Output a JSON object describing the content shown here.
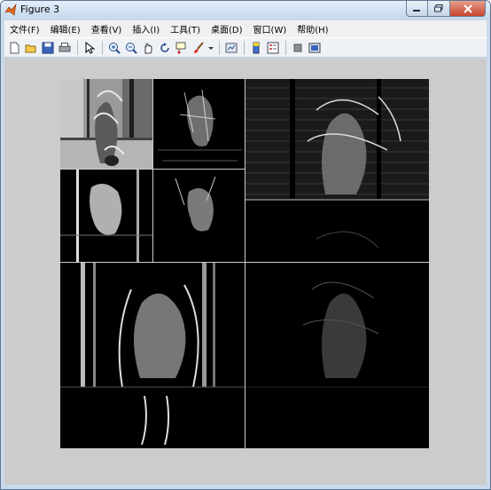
{
  "window": {
    "title": "Figure 3"
  },
  "menu": [
    "文件(F)",
    "编辑(E)",
    "查看(V)",
    "插入(I)",
    "工具(T)",
    "桌面(D)",
    "窗口(W)",
    "帮助(H)"
  ],
  "toolbar": {
    "icons": [
      "new-figure-icon",
      "open-file-icon",
      "save-icon",
      "print-icon",
      "pointer-icon",
      "zoom-in-icon",
      "zoom-out-icon",
      "pan-icon",
      "rotate-icon",
      "data-cursor-icon",
      "brush-icon",
      "dropdown-icon",
      "link-plot-icon",
      "colorbar-icon",
      "legend-icon",
      "hide-plot-tools-icon",
      "show-plot-tools-icon"
    ]
  },
  "figure": {
    "background": "#cccccc",
    "panels": [
      "approximation",
      "detail-horizontal-1",
      "detail-vertical-1",
      "detail-diagonal-1",
      "detail-horizontal-2",
      "detail-vertical-2",
      "detail-diagonal-2"
    ]
  }
}
